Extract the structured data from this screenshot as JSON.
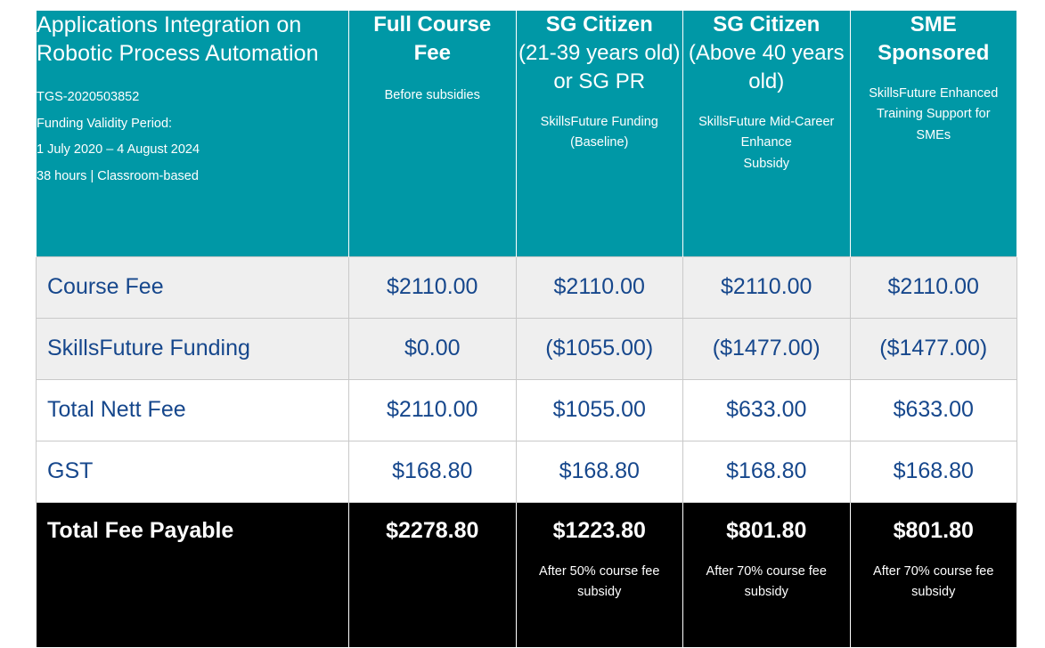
{
  "table": {
    "header": {
      "course": {
        "title": "Applications Integration on Robotic Process Automation",
        "code": "TGS-2020503852",
        "funding_label": "Funding Validity Period:",
        "funding_period": "1 July 2020 – 4 August 2024",
        "duration_mode": "38 hours | Classroom-based"
      },
      "columns": [
        {
          "title_strong": "Full Course",
          "title_strong_2": "Fee",
          "title_reg": "",
          "title_reg_2": "",
          "sub_1": "Before subsidies",
          "sub_2": ""
        },
        {
          "title_strong": "SG Citizen",
          "title_strong_2": "",
          "title_reg": "(21-39 years old)",
          "title_reg_2": "or SG PR",
          "sub_1": "SkillsFuture Funding",
          "sub_2": "(Baseline)"
        },
        {
          "title_strong": "SG Citizen",
          "title_strong_2": "",
          "title_reg": "(Above 40 years old)",
          "title_reg_2": "",
          "sub_1": "SkillsFuture Mid-Career Enhance",
          "sub_2": "Subsidy"
        },
        {
          "title_strong": "SME",
          "title_strong_2": "Sponsored",
          "title_reg": "",
          "title_reg_2": "",
          "sub_1": "SkillsFuture Enhanced Training Support for",
          "sub_2": "SMEs"
        }
      ]
    },
    "rows": [
      {
        "label": "Course Fee",
        "values": [
          "$2110.00",
          "$2110.00",
          "$2110.00",
          "$2110.00"
        ]
      },
      {
        "label": "SkillsFuture Funding",
        "values": [
          "$0.00",
          "($1055.00)",
          "($1477.00)",
          "($1477.00)"
        ]
      },
      {
        "label": "Total Nett Fee",
        "values": [
          "$2110.00",
          "$1055.00",
          "$633.00",
          "$633.00"
        ]
      },
      {
        "label": "GST",
        "values": [
          "$168.80",
          "$168.80",
          "$168.80",
          "$168.80"
        ]
      }
    ],
    "total_row": {
      "label": "Total Fee Payable",
      "values": [
        "$2278.80",
        "$1223.80",
        "$801.80",
        "$801.80"
      ],
      "notes": [
        "",
        "After 50% course fee subsidy",
        "After 70% course fee subsidy",
        "After 70% course fee subsidy"
      ]
    },
    "colors": {
      "header_teal": "#0098a6",
      "text_navy": "#16478c",
      "row_shaded": "#efefef",
      "total_bg": "#000000",
      "border": "#c9c9c9"
    }
  }
}
